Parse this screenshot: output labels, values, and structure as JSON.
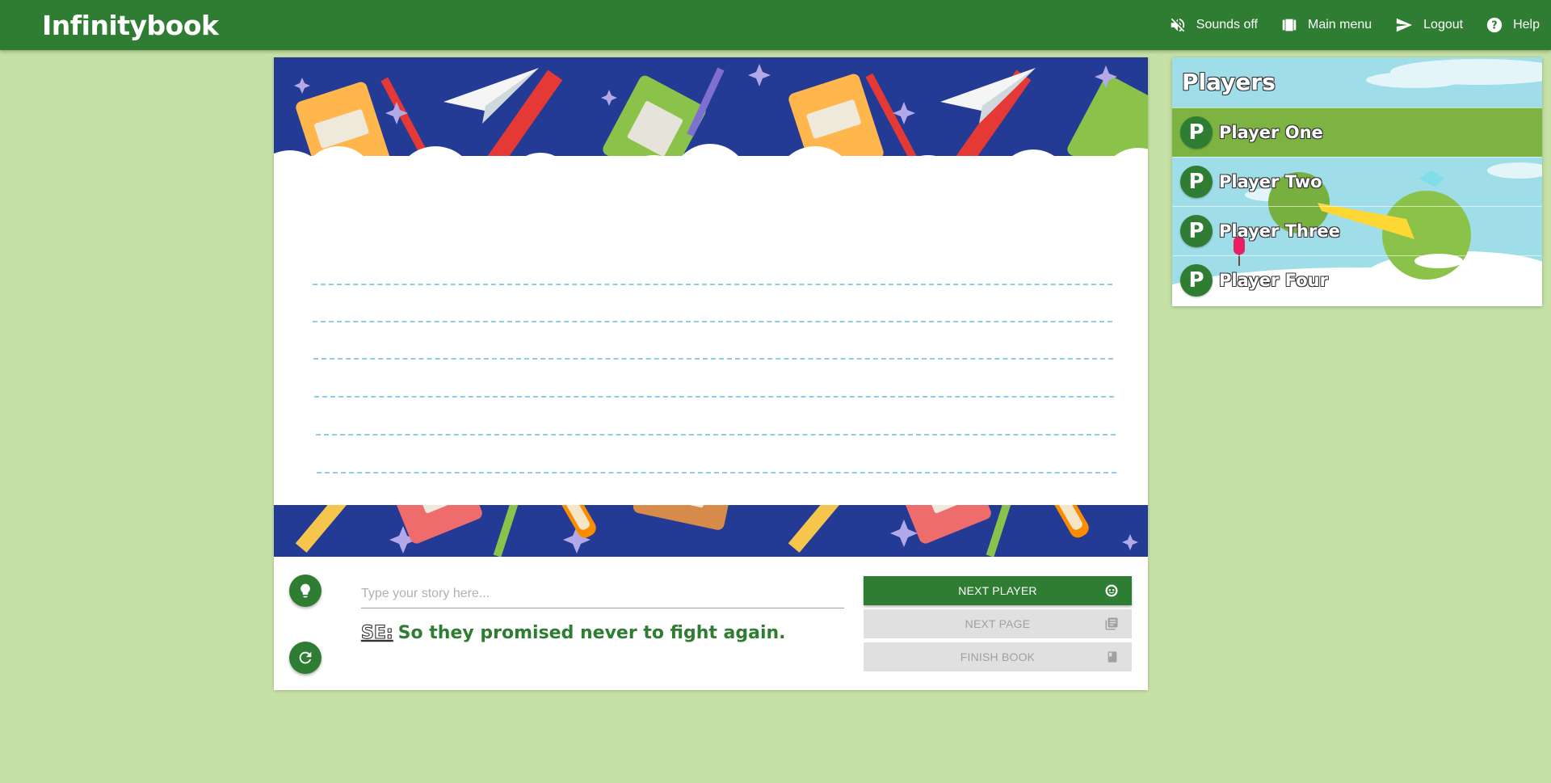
{
  "app": {
    "brand": "Infinitybook"
  },
  "nav": {
    "sounds": {
      "label": "Sounds off",
      "icon": "volume-off-icon"
    },
    "main_menu": {
      "label": "Main menu",
      "icon": "book-open-icon"
    },
    "logout": {
      "label": "Logout",
      "icon": "send-icon"
    },
    "help": {
      "label": "Help",
      "icon": "help-circle-icon"
    }
  },
  "story": {
    "placeholder": "Type your story here...",
    "value": "",
    "sentence_prefix": "SE:",
    "sentence_text": "So they promised never to fight again."
  },
  "actions": {
    "next_player": "NEXT PLAYER",
    "next_page": "NEXT PAGE",
    "finish_book": "FINISH BOOK"
  },
  "players": {
    "title": "Players",
    "list": [
      {
        "initial": "P",
        "name": "Player One",
        "active": true
      },
      {
        "initial": "P",
        "name": "Player Two",
        "active": false
      },
      {
        "initial": "P",
        "name": "Player Three",
        "active": false
      },
      {
        "initial": "P",
        "name": "Player Four",
        "active": false
      }
    ]
  },
  "colors": {
    "primary": "#2e7d32",
    "active_row": "#7cb342",
    "background": "#c5e1a5",
    "scene_background": "#233b94",
    "ruled_line": "#8fcde0"
  }
}
